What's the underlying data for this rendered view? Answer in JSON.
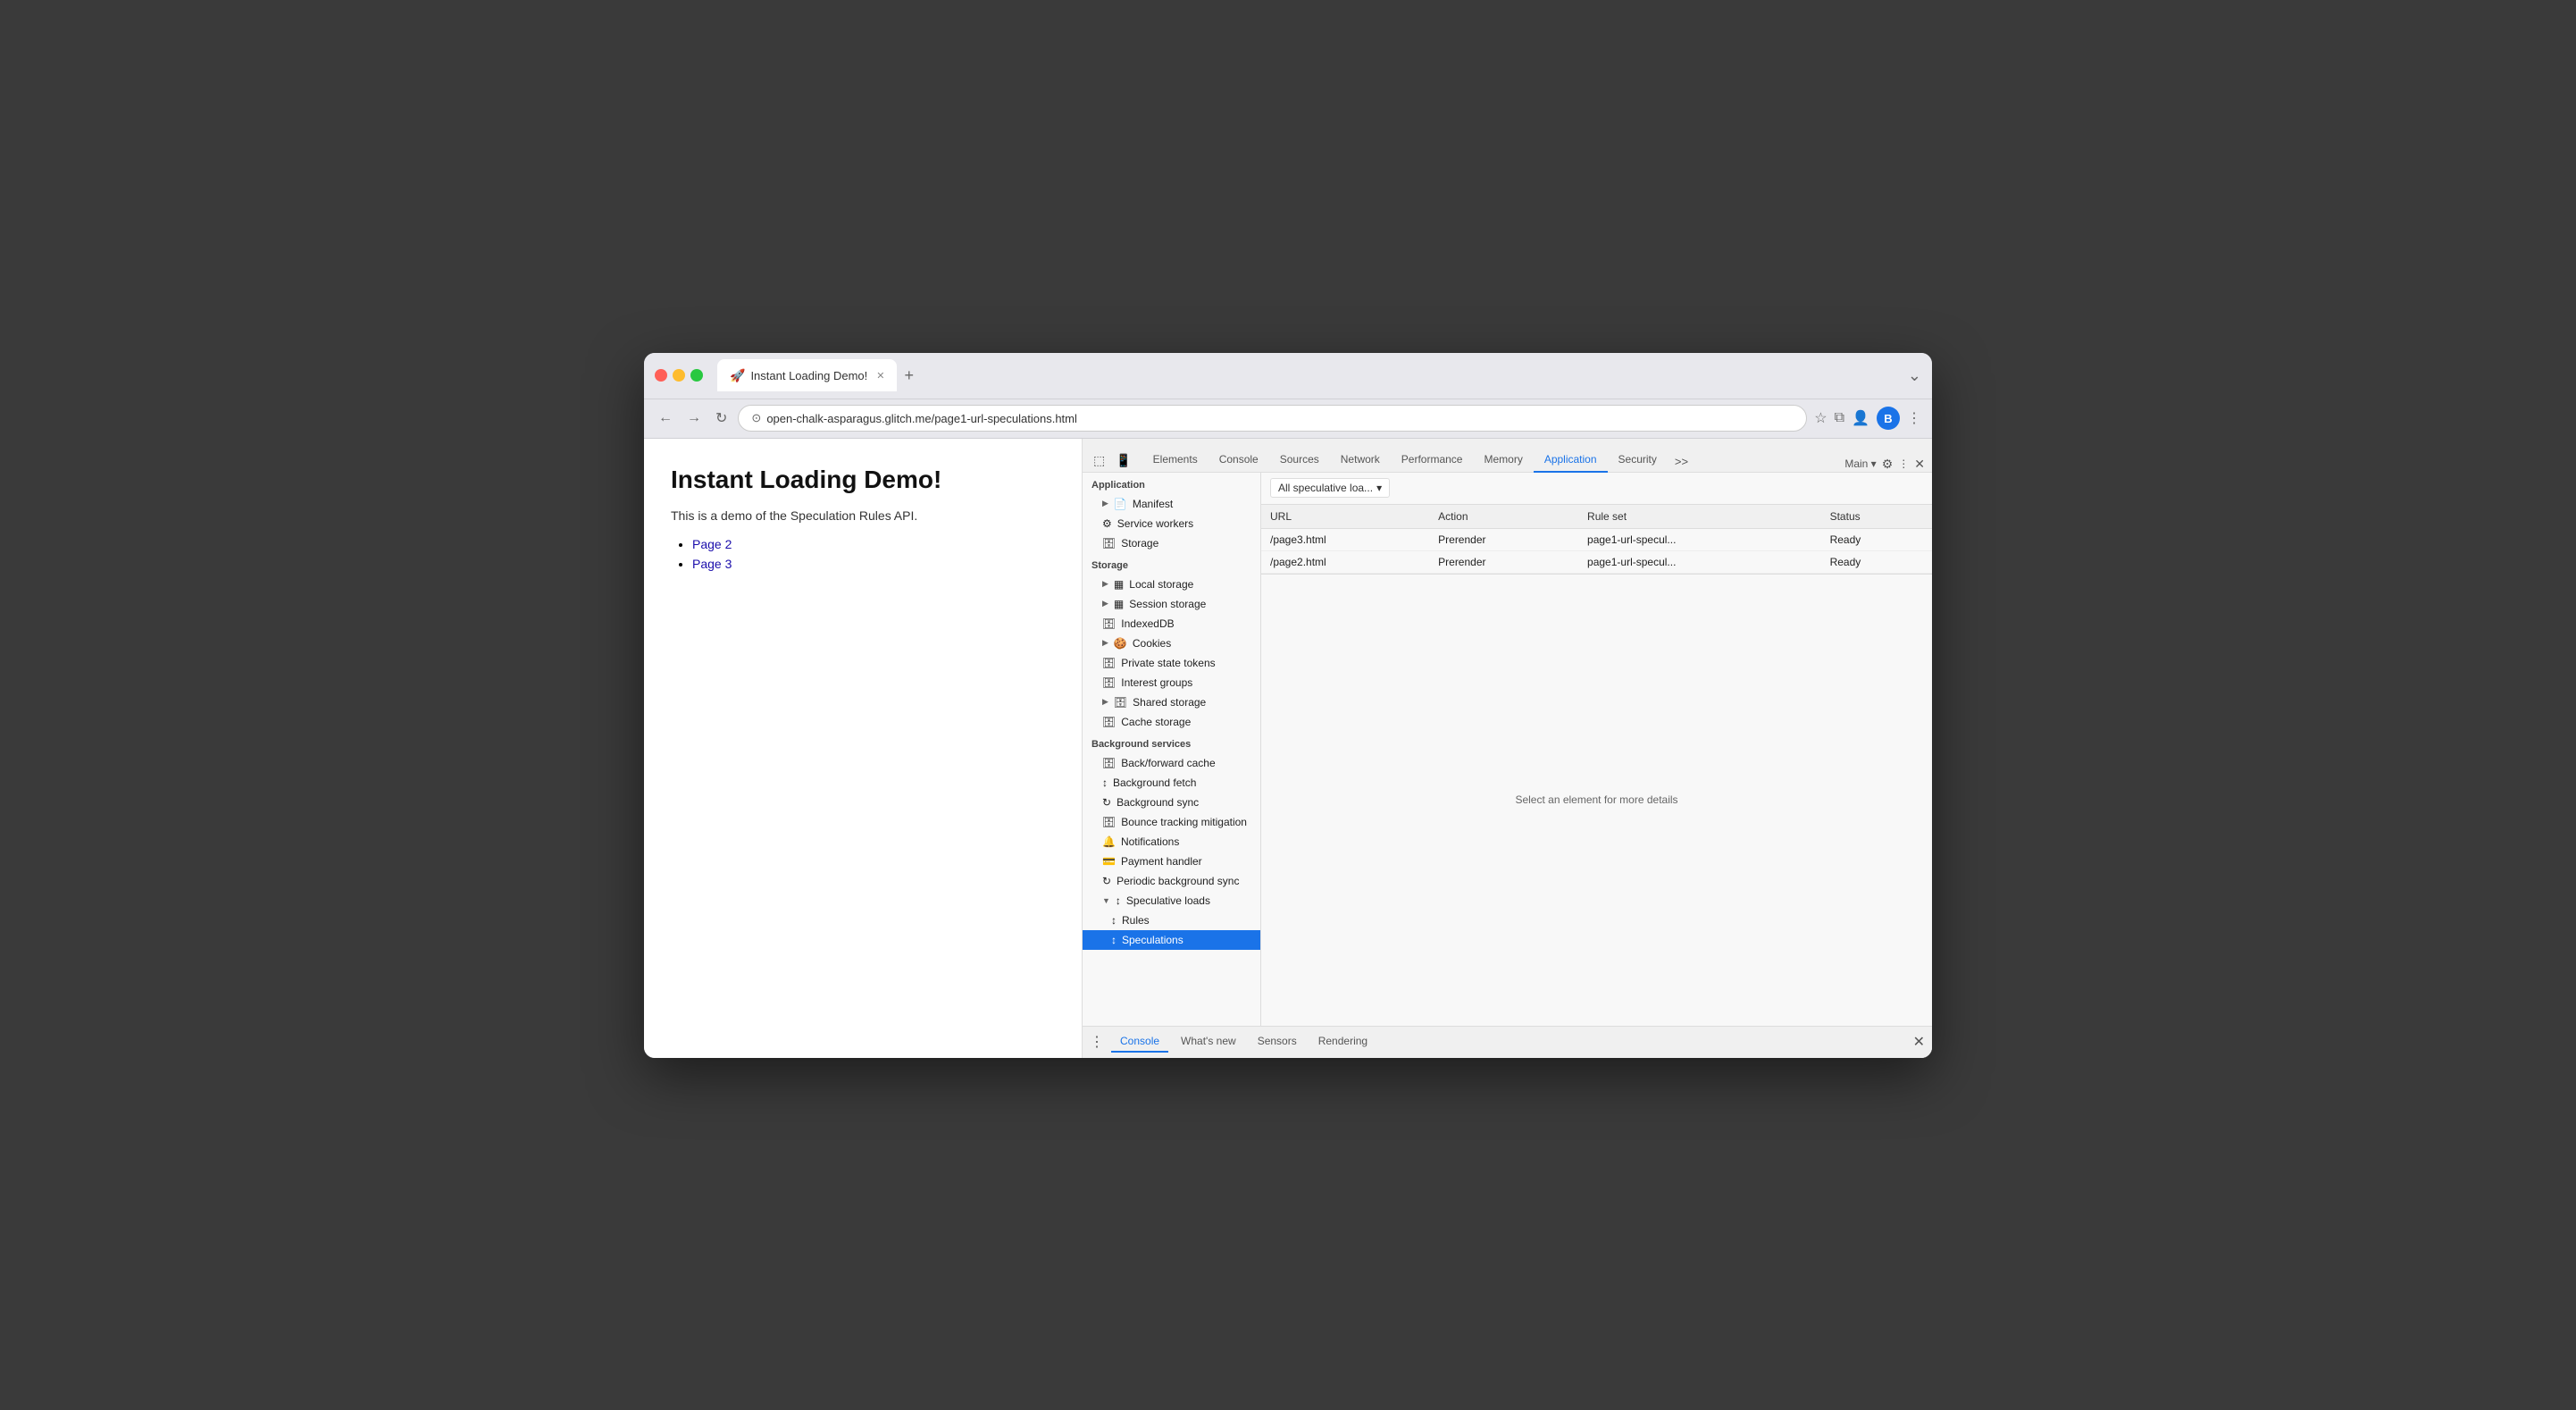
{
  "browser": {
    "tab_title": "Instant Loading Demo!",
    "url": "open-chalk-asparagus.glitch.me/page1-url-speculations.html",
    "new_tab_symbol": "+",
    "avatar_label": "B"
  },
  "page": {
    "title": "Instant Loading Demo!",
    "description": "This is a demo of the Speculation Rules API.",
    "links": [
      "Page 2",
      "Page 3"
    ]
  },
  "devtools": {
    "tabs": [
      "Elements",
      "Console",
      "Sources",
      "Network",
      "Performance",
      "Memory",
      "Application",
      "Security"
    ],
    "active_tab": "Application",
    "more_tabs": ">>",
    "context": "Main",
    "settings_icon": "⚙",
    "close_icon": "✕",
    "toolbar_dropdown": "All speculative loa...",
    "table": {
      "headers": [
        "URL",
        "Action",
        "Rule set",
        "Status"
      ],
      "rows": [
        {
          "url": "/page3.html",
          "action": "Prerender",
          "rule_set": "page1-url-specul...",
          "status": "Ready"
        },
        {
          "url": "/page2.html",
          "action": "Prerender",
          "rule_set": "page1-url-specul...",
          "status": "Ready"
        }
      ]
    },
    "detail_text": "Select an element for more details"
  },
  "sidebar": {
    "application_label": "Application",
    "app_items": [
      {
        "label": "Manifest",
        "icon": "📄",
        "indent": 1,
        "has_arrow": true
      },
      {
        "label": "Service workers",
        "icon": "⚙",
        "indent": 1
      },
      {
        "label": "Storage",
        "icon": "🗄",
        "indent": 1
      }
    ],
    "storage_label": "Storage",
    "storage_items": [
      {
        "label": "Local storage",
        "icon": "▦",
        "indent": 1,
        "has_arrow": true
      },
      {
        "label": "Session storage",
        "icon": "▦",
        "indent": 1,
        "has_arrow": true
      },
      {
        "label": "IndexedDB",
        "icon": "🗄",
        "indent": 1
      },
      {
        "label": "Cookies",
        "icon": "🍪",
        "indent": 1,
        "has_arrow": true
      },
      {
        "label": "Private state tokens",
        "icon": "🗄",
        "indent": 1
      },
      {
        "label": "Interest groups",
        "icon": "🗄",
        "indent": 1
      },
      {
        "label": "Shared storage",
        "icon": "🗄",
        "indent": 1,
        "has_arrow": true
      },
      {
        "label": "Cache storage",
        "icon": "🗄",
        "indent": 1
      }
    ],
    "bg_services_label": "Background services",
    "bg_services_items": [
      {
        "label": "Back/forward cache",
        "icon": "🗄",
        "indent": 1
      },
      {
        "label": "Background fetch",
        "icon": "↕",
        "indent": 1
      },
      {
        "label": "Background sync",
        "icon": "↻",
        "indent": 1
      },
      {
        "label": "Bounce tracking mitigation",
        "icon": "🗄",
        "indent": 1
      },
      {
        "label": "Notifications",
        "icon": "🔔",
        "indent": 1
      },
      {
        "label": "Payment handler",
        "icon": "💳",
        "indent": 1
      },
      {
        "label": "Periodic background sync",
        "icon": "↻",
        "indent": 1
      },
      {
        "label": "Speculative loads",
        "icon": "↕",
        "indent": 1,
        "has_arrow": true,
        "expanded": true
      },
      {
        "label": "Rules",
        "icon": "↕",
        "indent": 2
      },
      {
        "label": "Speculations",
        "icon": "↕",
        "indent": 2,
        "active": true
      }
    ]
  },
  "bottom_bar": {
    "dots": "⋮",
    "tabs": [
      "Console",
      "What's new",
      "Sensors",
      "Rendering"
    ],
    "active_tab": "Console",
    "close_icon": "✕"
  }
}
